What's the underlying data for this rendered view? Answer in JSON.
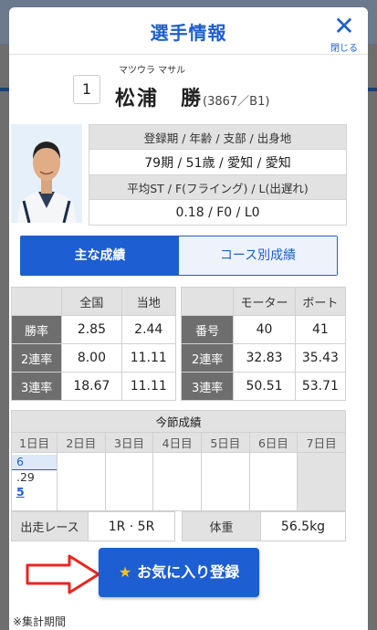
{
  "modal": {
    "title": "選手情報",
    "close_label": "閉じる"
  },
  "racer": {
    "number": "1",
    "kana": "マツウラ マサル",
    "name": "松浦　勝",
    "registration": "(3867／B1)"
  },
  "profile": {
    "header1": "登録期 / 年齢 / 支部 / 出身地",
    "value1": "79期 / 51歳 / 愛知 / 愛知",
    "header2": "平均ST / F(フライング) / L(出遅れ)",
    "value2": "0.18 / F0 / L0"
  },
  "tabs": [
    "主な成績",
    "コース別成績"
  ],
  "stats": {
    "col_national": "全国",
    "col_local": "当地",
    "col_motor": "モーター",
    "col_boat": "ボート",
    "rows": [
      {
        "label": "勝率",
        "national": "2.85",
        "local": "2.44",
        "mlabel": "番号",
        "motor": "40",
        "boat": "41"
      },
      {
        "label": "2連率",
        "national": "8.00",
        "local": "11.11",
        "mlabel": "2連率",
        "motor": "32.83",
        "boat": "35.43"
      },
      {
        "label": "3連率",
        "national": "18.67",
        "local": "11.11",
        "mlabel": "3連率",
        "motor": "50.51",
        "boat": "53.71"
      }
    ]
  },
  "session": {
    "title": "今節成績",
    "days": [
      "1日目",
      "2日目",
      "3日目",
      "4日目",
      "5日目",
      "6日目",
      "7日目"
    ],
    "day1": {
      "course": "6",
      "time": ".29",
      "rank": "5"
    }
  },
  "bottom": {
    "race_label": "出走レース",
    "race_value": "1R · 5R",
    "weight_label": "体重",
    "weight_value": "56.5kg"
  },
  "favorite_button": "お気に入り登録",
  "note": "※集計期間",
  "colors": {
    "accent": "#1d5fd2",
    "arrow": "#e8251f",
    "star": "#f7c21b"
  }
}
